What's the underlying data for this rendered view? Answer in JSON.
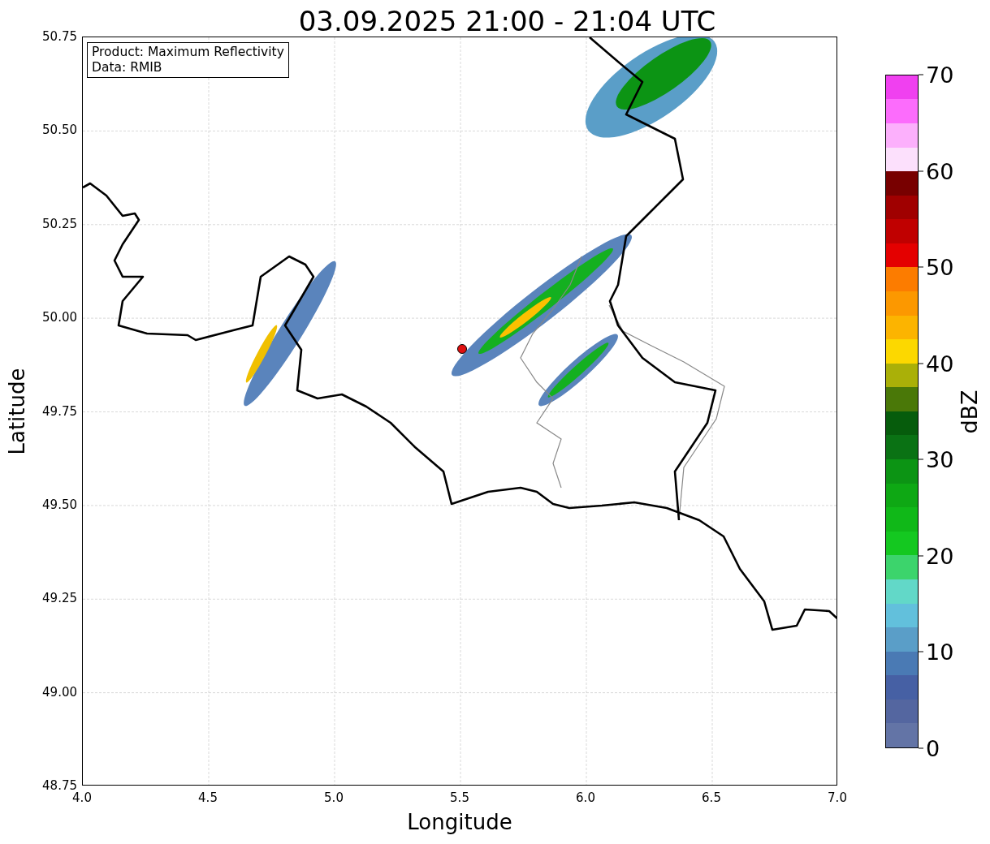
{
  "title": "03.09.2025 21:00 - 21:04 UTC",
  "plot": {
    "xlabel": "Longitude",
    "ylabel": "Latitude",
    "xticks": [
      "4.0",
      "4.5",
      "5.0",
      "5.5",
      "6.0",
      "6.5",
      "7.0"
    ],
    "yticks": [
      "50.75",
      "50.50",
      "50.25",
      "50.00",
      "49.75",
      "49.50",
      "49.25",
      "49.00",
      "48.75"
    ],
    "legend": [
      "Product: Maximum Reflectivity",
      "Data: RMIB"
    ]
  },
  "colorbar": {
    "label": "dBZ",
    "ticks": [
      "70",
      "60",
      "50",
      "40",
      "30",
      "20",
      "10",
      "0"
    ],
    "bins": [
      {
        "color": "#6374a6"
      },
      {
        "color": "#5466a0"
      },
      {
        "color": "#4660a4"
      },
      {
        "color": "#4a7ab4"
      },
      {
        "color": "#5a9ec8"
      },
      {
        "color": "#62c0dc"
      },
      {
        "color": "#62d8c8"
      },
      {
        "color": "#3cd46c"
      },
      {
        "color": "#14c820"
      },
      {
        "color": "#10b818"
      },
      {
        "color": "#0ea814"
      },
      {
        "color": "#0c9414"
      },
      {
        "color": "#0a7214"
      },
      {
        "color": "#065c0c"
      },
      {
        "color": "#4a7808"
      },
      {
        "color": "#aab008"
      },
      {
        "color": "#fcd800"
      },
      {
        "color": "#fcb400"
      },
      {
        "color": "#fc9800"
      },
      {
        "color": "#fc7c00"
      },
      {
        "color": "#e40000"
      },
      {
        "color": "#c00000"
      },
      {
        "color": "#a00000"
      },
      {
        "color": "#780000"
      },
      {
        "color": "#fce0fc"
      },
      {
        "color": "#fcb0fc"
      },
      {
        "color": "#fc6cfc"
      },
      {
        "color": "#f040f0"
      }
    ]
  }
}
